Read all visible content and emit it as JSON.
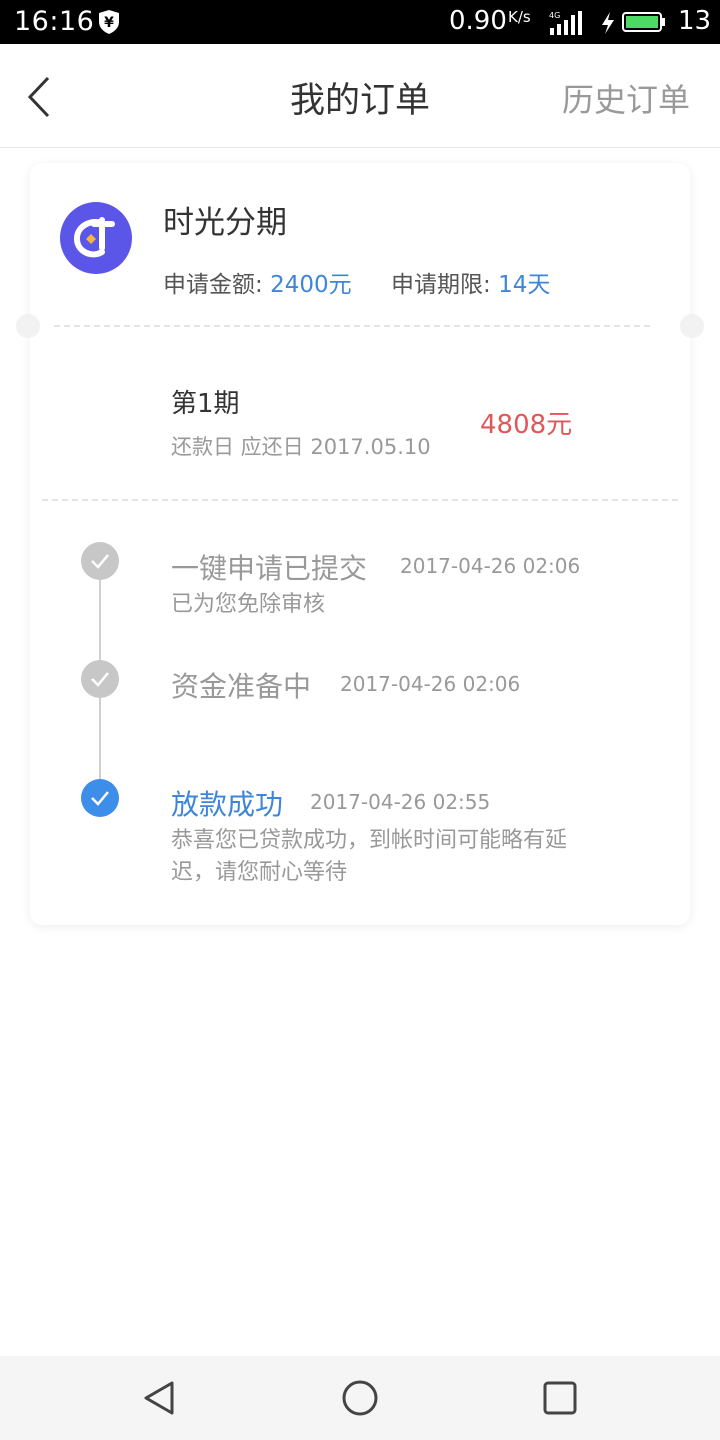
{
  "status_bar": {
    "time": "16:16",
    "net_speed": "0.90",
    "net_unit": "K/s",
    "battery_level": "13"
  },
  "navbar": {
    "title": "我的订单",
    "right_link": "历史订单"
  },
  "order": {
    "product_name": "时光分期",
    "amount_label": "申请金额: ",
    "amount_value": "2400元",
    "term_label": "申请期限: ",
    "term_value": "14天",
    "period_label": "第1期",
    "due_text": "还款日 应还日 2017.05.10",
    "due_amount": "4808元"
  },
  "timeline": [
    {
      "title": "一键申请已提交",
      "time": "2017-04-26 02:06",
      "desc": "已为您免除审核",
      "active": false
    },
    {
      "title": "资金准备中",
      "time": "2017-04-26 02:06",
      "desc": "",
      "active": false
    },
    {
      "title": "放款成功",
      "time": "2017-04-26 02:55",
      "desc": "恭喜您已贷款成功，到帐时间可能略有延迟，请您耐心等待",
      "active": true
    }
  ],
  "colors": {
    "accent_blue": "#3f86d9",
    "amount_red": "#e0575a",
    "logo_purple": "#5b56e8",
    "logo_orange": "#f5b53f"
  },
  "icons": {
    "back": "chevron-left-icon",
    "status_done": "check-icon",
    "sys_back": "triangle-back-icon",
    "sys_home": "circle-home-icon",
    "sys_recent": "square-recent-icon"
  }
}
